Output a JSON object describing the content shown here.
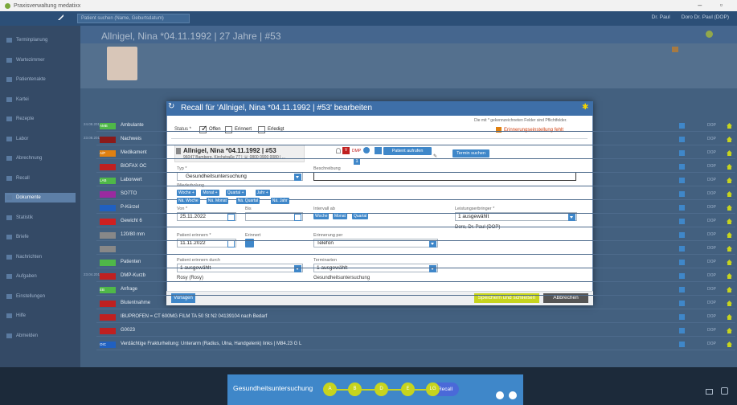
{
  "app": {
    "title": "Praxisverwaltung medatixx"
  },
  "topbar": {
    "search_placeholder": "Patient suchen (Name, Geburtsdatum)",
    "user1": "Dr. Paul",
    "user2": "Doro Dr. Paul (DOP)"
  },
  "sidebar": {
    "items": [
      "Terminplanung",
      "Wartezimmer",
      "Patientenakte",
      "Kartei",
      "Rezepte",
      "Labor",
      "Abrechnung",
      "Recall",
      "Dokumente",
      "Statistik",
      "Briefe",
      "Nachrichten",
      "Aufgaben",
      "Einstellungen",
      "Hilfe",
      "Abmelden"
    ]
  },
  "patient": {
    "header_title": "Allnigel, Nina *04.11.1992 | 27 Jahre | #53"
  },
  "list": {
    "rows": [
      {
        "date": "24.08.2018",
        "code": "AMB",
        "text": "Ambulante",
        "color": "#4fb848"
      },
      {
        "date": "23.08.2018",
        "code": "",
        "text": "Nachweis",
        "color": "#8b1a1a"
      },
      {
        "date": "",
        "code": "A/P",
        "text": "Medikament",
        "color": "#e08010"
      },
      {
        "date": "",
        "code": "",
        "text": "BIOFAX OC",
        "color": "#c02020"
      },
      {
        "date": "",
        "code": "LAB",
        "text": "Laborwert",
        "color": "#4fb848"
      },
      {
        "date": "",
        "code": "",
        "text": "SO7TO",
        "color": "#9a2aa0"
      },
      {
        "date": "",
        "code": "",
        "text": "P-Kürzel",
        "color": "#2060c0"
      },
      {
        "date": "",
        "code": "",
        "text": "Gewicht 6",
        "color": "#d02020"
      },
      {
        "date": "",
        "code": "",
        "text": "120/80 mm",
        "color": "#888"
      },
      {
        "date": "",
        "code": "",
        "text": "",
        "color": "#888"
      },
      {
        "date": "",
        "code": "",
        "text": "Patienten",
        "color": "#4fb848"
      },
      {
        "date": "23.04.2019",
        "code": "",
        "text": "DMP-Kurzb",
        "color": "#c02020"
      },
      {
        "date": "",
        "code": "EB",
        "text": "Anfrage",
        "color": "#4fb848"
      },
      {
        "date": "",
        "code": "",
        "text": "Blutentnahme",
        "color": "#c02020"
      },
      {
        "date": "",
        "code": "",
        "text": "IBUPROFEN = CT 600MG FILM TA 50 St N2 04139104 nach Bedarf",
        "color": "#c02020"
      },
      {
        "date": "",
        "code": "",
        "text": "G0023",
        "color": "#c02020"
      },
      {
        "date": "",
        "code": "OIC",
        "text": "Verdächtige Frakturheilung: Unterarm (Radius, Ulna, Handgelenk) links | M84.23 G L",
        "color": "#2060c0"
      }
    ],
    "right_labels": [
      "DOP",
      "DOP",
      "DOP",
      "DOP",
      "DOP",
      "DOP",
      "DOP",
      "DOP",
      "DOP",
      "DOP",
      "DOP",
      "DOP",
      "DOP",
      "DOP",
      "DOP",
      "DOP",
      "DOP"
    ]
  },
  "modal": {
    "title": "Recall für 'Allnigel, Nina *04.11.1992 | #53' bearbeiten",
    "hint": "Die mit * gekennzeichneten Felder sind Pflichtfelder.",
    "status_label": "Status *",
    "status_options": [
      "Offen",
      "Erinnert",
      "Erledigt"
    ],
    "warning": "Erinnerungseinstellung fehlt",
    "patient_name": "Allnigel, Nina *04.11.1992 | #53",
    "patient_address": "96047 Bamberg, Kirchstraße 77 | ☏ 0800 0900 0080 | ...",
    "patient_button": "Patient aufrufen",
    "appointment_button": "Termin suchen",
    "dmp": "DMP",
    "typ_label": "Typ *",
    "typ_value": "Gesundheitsuntersuchung",
    "beschreibung_label": "Beschreibung",
    "wiederholung_label": "Wiederholung",
    "chips_row1": [
      "Woche +",
      "Monat +",
      "Quartal +",
      "Jahr +"
    ],
    "chips_row2": [
      "Nä. Woche",
      "Nä. Monat",
      "Nä. Quartal",
      "Nä. Jahr"
    ],
    "von_label": "Von *",
    "von_value": "25.11.2022",
    "bis_label": "Bis",
    "intervall_label": "Intervall ab",
    "intervall_chips": [
      "Woche",
      "Monat",
      "Quartal"
    ],
    "leistung_label": "Leistungserbringer *",
    "leistung_value": "1 ausgewählt",
    "leistung_doctor": "Doro, Dr. Paul (DOP)",
    "erinnern_label": "Patient erinnern *",
    "erinnern_value": "11.11.2022",
    "erinnern_icon_label": "Erinnert",
    "erinnerung_per_label": "Erinnerung per",
    "erinnerung_per_value": "Telefon",
    "erinnern_durch_label": "Patient erinnern durch",
    "erinnern_durch_value": "1 ausgewählt",
    "erinnern_durch_person": "Rosy (Rosy)",
    "terminarten_label": "Terminarten",
    "terminarten_value": "1 ausgewählt",
    "terminarten_sub": "Gesundheitsuntersuchung",
    "vorlagen_button": "Vorlagen",
    "save_button": "Speichern und schließen",
    "cancel_button": "Abbrechen"
  },
  "workflow": {
    "label": "Gesundheitsuntersuchung",
    "steps": [
      "A",
      "B",
      "D",
      "E",
      "LG"
    ],
    "recall": "Recall"
  }
}
